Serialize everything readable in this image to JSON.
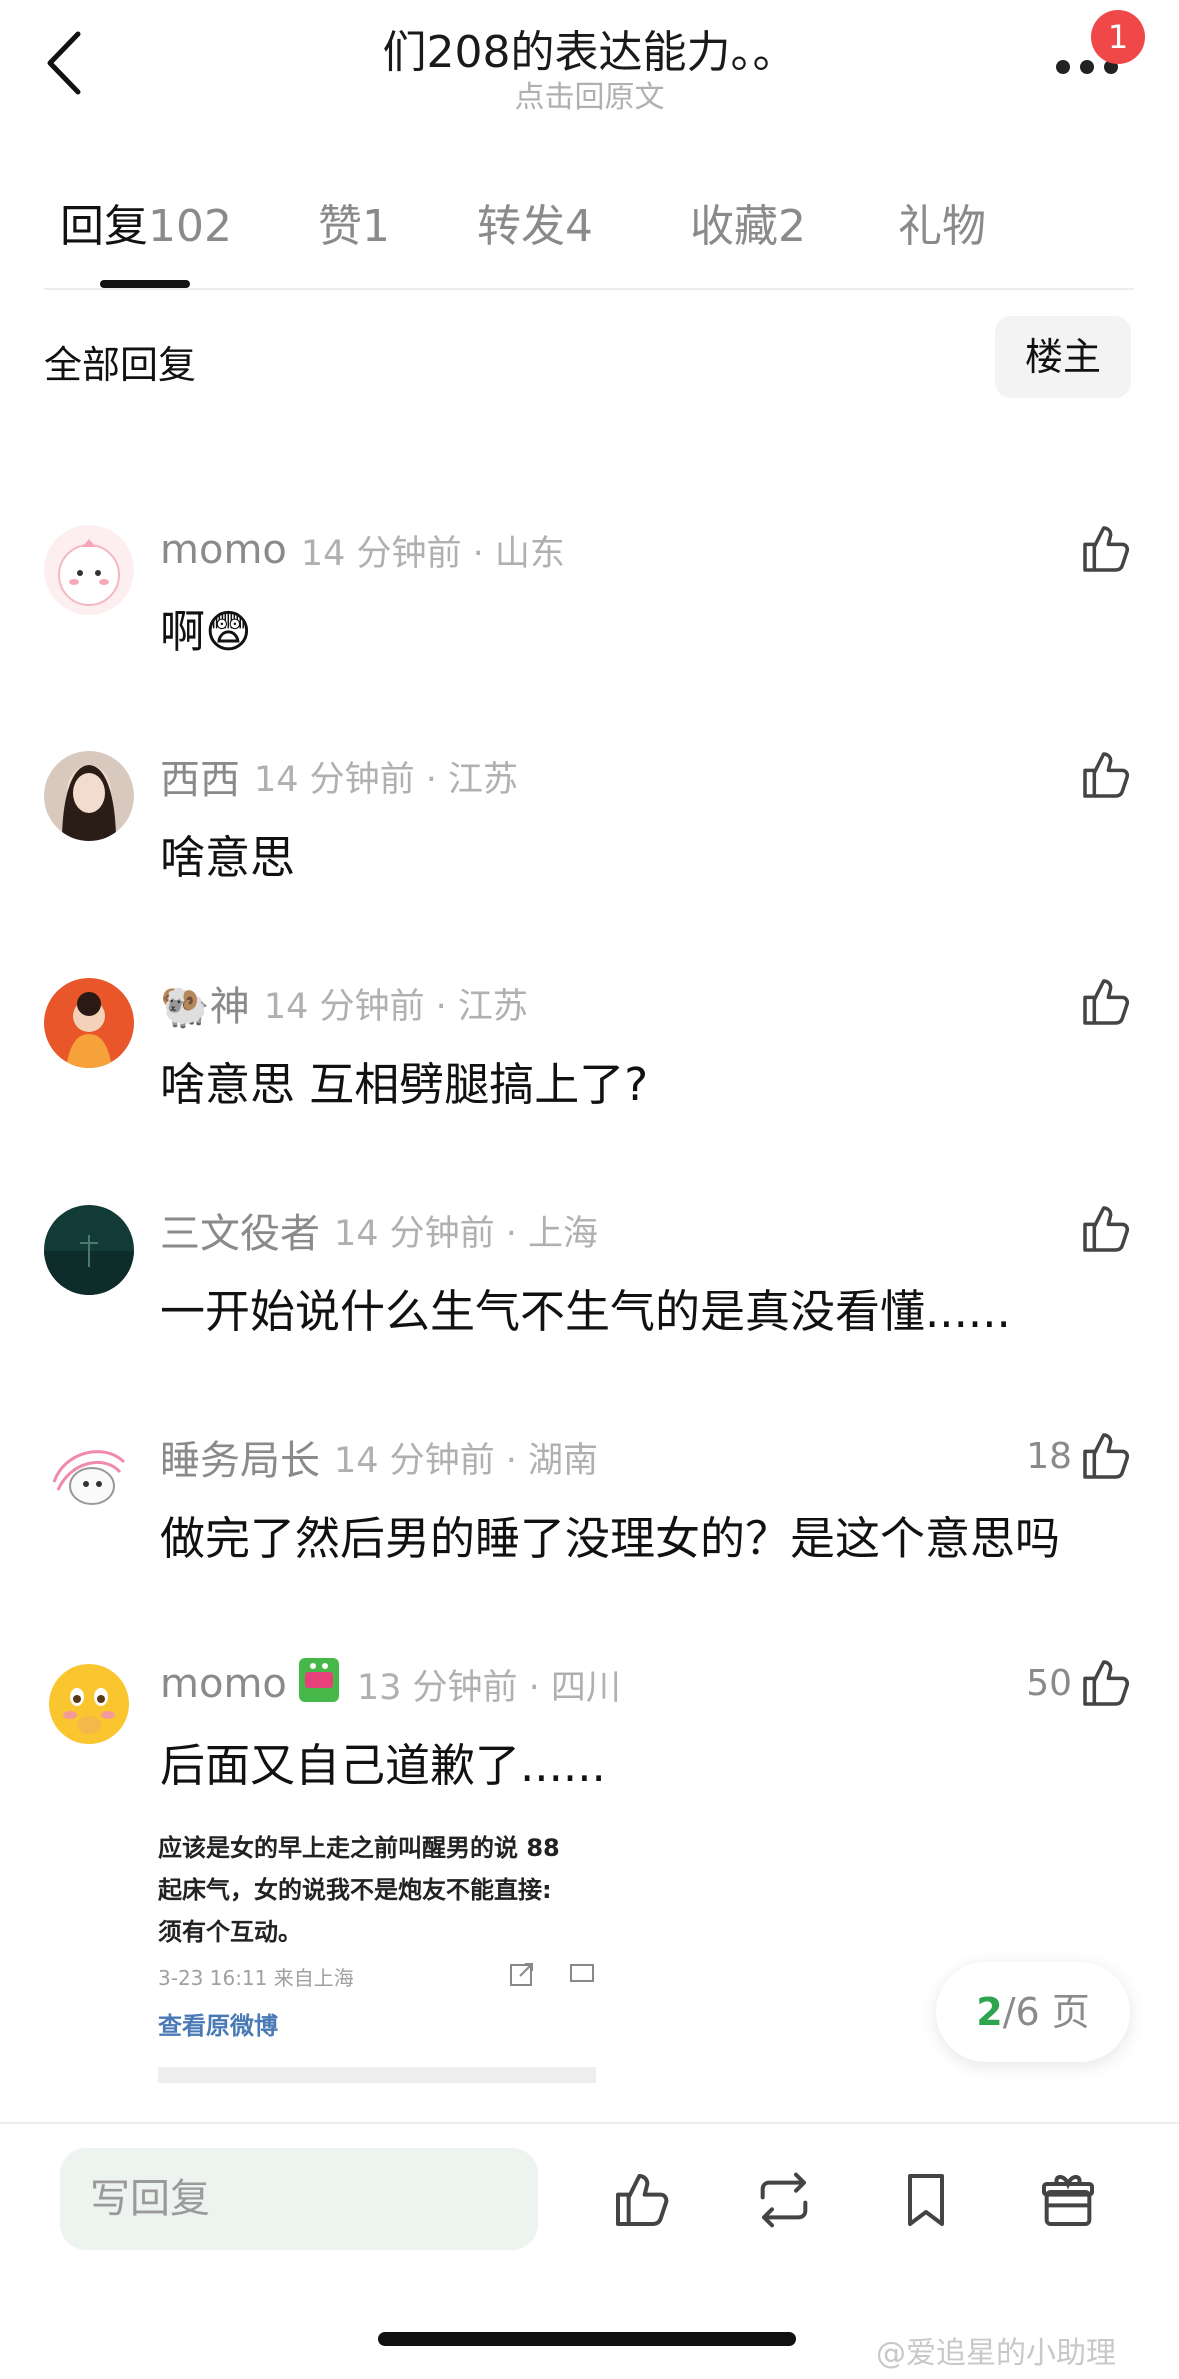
{
  "header": {
    "title": "们208的表达能力。。",
    "subtitle": "点击回原文",
    "badge_count": "1"
  },
  "tabs": [
    {
      "label": "回复",
      "count": "102",
      "active": true
    },
    {
      "label": "赞",
      "count": "1"
    },
    {
      "label": "转发",
      "count": "4"
    },
    {
      "label": "收藏",
      "count": "2"
    },
    {
      "label": "礼物",
      "count": ""
    }
  ],
  "filter": {
    "label": "全部回复",
    "op_button": "楼主"
  },
  "comments": [
    {
      "user": "momo",
      "time": "14 分钟前 · 山东",
      "text": "啊😨",
      "likes": ""
    },
    {
      "user": "西西",
      "time": "14 分钟前 · 江苏",
      "text": "啥意思",
      "likes": ""
    },
    {
      "user": "🐏神",
      "time": "14 分钟前 · 江苏",
      "text": "啥意思 互相劈腿搞上了?",
      "likes": ""
    },
    {
      "user": "三文役者",
      "time": "14 分钟前 · 上海",
      "text": "一开始说什么生气不生气的是真没看懂......",
      "likes": ""
    },
    {
      "user": "睡务局长",
      "time": "14 分钟前 · 湖南",
      "text": "做完了然后男的睡了没理女的？是这个意思吗",
      "likes": "18"
    },
    {
      "user": "momo",
      "time": "13 分钟前 · 四川",
      "text": "后面又自己道歉了......",
      "likes": "50"
    }
  ],
  "snippet": {
    "line1": "应该是女的早上走之前叫醒男的说 88",
    "line2": "起床气，女的说我不是炮友不能直接:",
    "line3": "须有个互动。",
    "meta": "3-23 16:11  来自上海",
    "link": "查看原微博"
  },
  "pager": {
    "current": "2",
    "total_text": "/6 页"
  },
  "bottom": {
    "reply_placeholder": "写回复"
  },
  "watermark": "@爱追星的小助理"
}
